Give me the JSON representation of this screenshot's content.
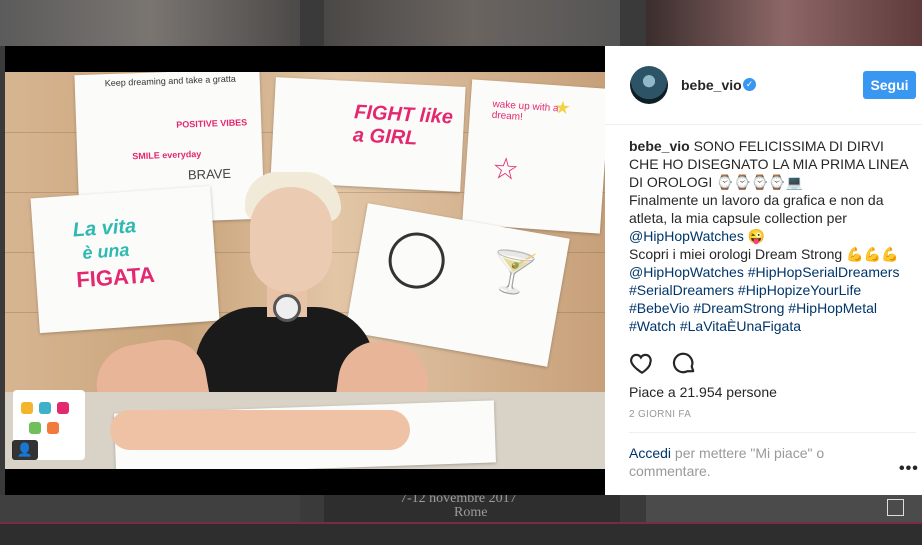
{
  "background": {
    "event_date": "7-12 novembre 2017",
    "event_city": "Rome"
  },
  "photo": {
    "sign_keep": "Keep dreaming and take a gratta",
    "sign_positive": "POSITIVE VIBES",
    "sign_fight": "FIGHT like a GIRL",
    "sign_vita_1": "La vita",
    "sign_vita_2": "è una",
    "sign_vita_3": "FIGATA",
    "sign_wake": "wake up with a dream!",
    "sign_smile": "SMILE everyday",
    "sign_brave": "BRAVE",
    "user_tag_icon": "person-icon"
  },
  "post": {
    "username": "bebe_vio",
    "verified": true,
    "follow_label": "Segui",
    "caption": {
      "author": "bebe_vio",
      "line1": "SONO FELICISSIMA DI DIRVI CHE HO DISEGNATO LA MIA PRIMA LINEA DI OROLOGI ⌚⌚⌚⌚💻",
      "line2_a": "Finalmente un lavoro da grafica e non da atleta, la mia capsule collection per ",
      "line2_tag": "@HipHopWatches",
      "line2_b": " 😜",
      "line3": "Scopri i miei orologi Dream Strong 💪💪💪",
      "tags": "@HipHopWatches #HipHopSerialDreamers #SerialDreamers #HipHopizeYourLife #BebeVio #DreamStrong #HipHopMetal #Watch #LaVitaÈUnaFigata"
    },
    "likes": "Piace a 21.954 persone",
    "timestamp": "2 GIORNI FA",
    "login_link": "Accedi",
    "login_rest": " per mettere \"Mi piace\" o commentare.",
    "more": "•••"
  },
  "colors": {
    "accent": "#3897f0",
    "link": "#003569",
    "muted": "#999999"
  }
}
